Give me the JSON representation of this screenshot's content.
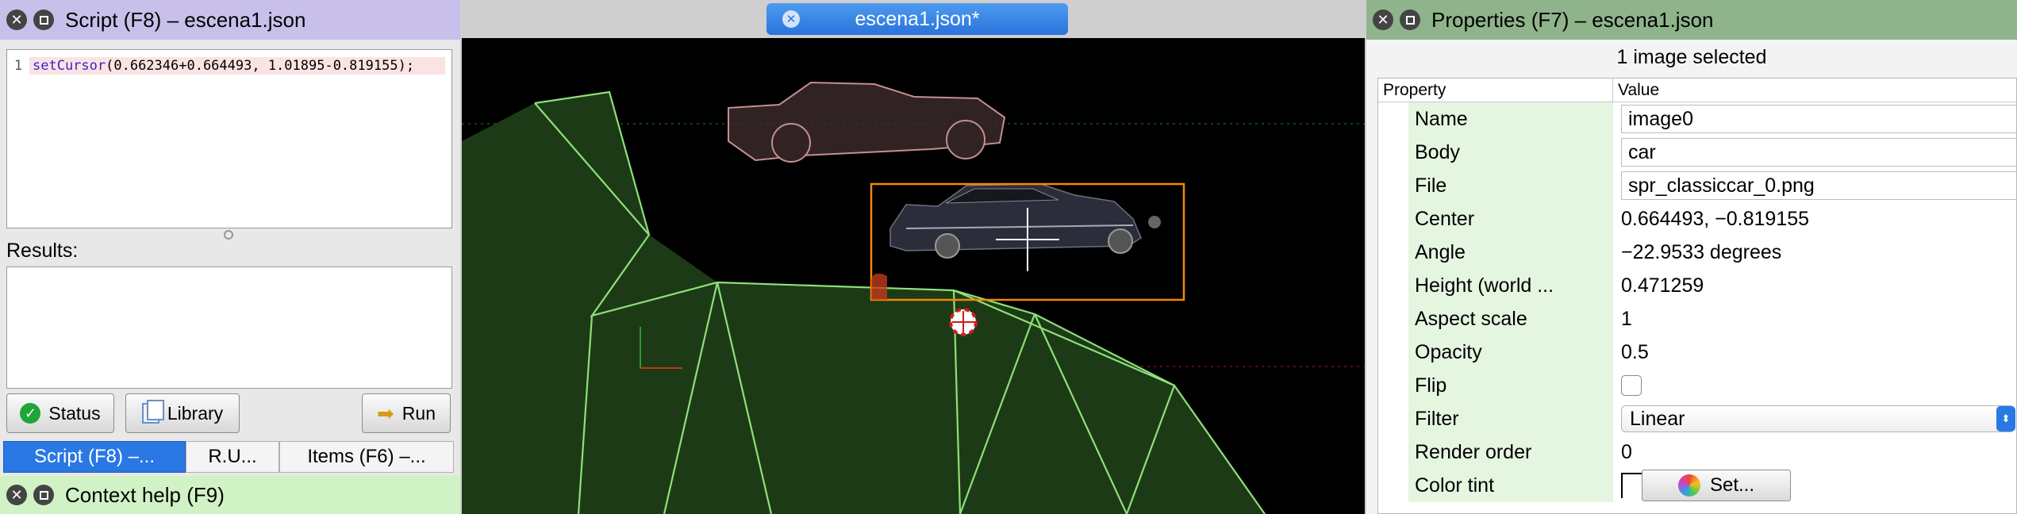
{
  "script_panel": {
    "title": "Script (F8) – escena1.json",
    "code_line_number": "1",
    "code_function": "setCursor",
    "code_args": "(0.662346+0.664493, 1.01895-0.819155);",
    "results_label": "Results:",
    "status_label": "Status",
    "library_label": "Library",
    "run_label": "Run",
    "tabs": [
      "Script (F8) –...",
      "R.U...",
      "Items (F6) –..."
    ],
    "context_help_title": "Context help (F9)"
  },
  "document_tab": {
    "label": "escena1.json*"
  },
  "properties_panel": {
    "title": "Properties (F7) – escena1.json",
    "selection_summary": "1 image selected",
    "col_property": "Property",
    "col_value": "Value",
    "rows": [
      {
        "name": "Name",
        "value": "image0"
      },
      {
        "name": "Body",
        "value": "car"
      },
      {
        "name": "File",
        "value": "spr_classiccar_0.png"
      },
      {
        "name": "Center",
        "value": "0.664493, −0.819155"
      },
      {
        "name": "Angle",
        "value": "−22.9533 degrees"
      },
      {
        "name": "Height (world ...",
        "value": "0.471259"
      },
      {
        "name": "Aspect scale",
        "value": "1"
      },
      {
        "name": "Opacity",
        "value": "0.5"
      },
      {
        "name": "Flip",
        "value": ""
      },
      {
        "name": "Filter",
        "value": "Linear"
      },
      {
        "name": "Render order",
        "value": "0"
      },
      {
        "name": "Color tint",
        "value": ""
      }
    ],
    "set_button_label": "Set...",
    "flip_checked": false
  },
  "colors": {
    "script_header": "#c8c0ea",
    "properties_header": "#8fb38a",
    "context_header": "#d1f2c5",
    "active_tab": "#2a78e4",
    "selection_box": "#f08a00",
    "polygon_stroke": "#8ee07a",
    "polygon_fill": "#1d3a16"
  }
}
